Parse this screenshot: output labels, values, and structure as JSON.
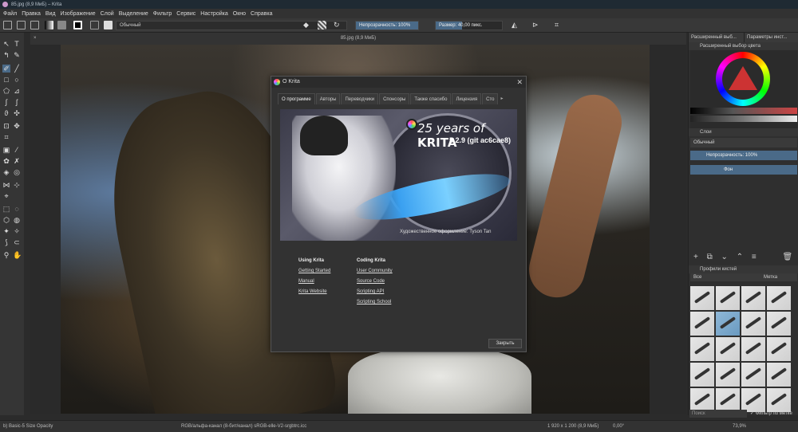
{
  "window": {
    "title": "85.jpg (8,9 МиБ) – Krita"
  },
  "menu": [
    "Файл",
    "Правка",
    "Вид",
    "Изображение",
    "Слой",
    "Выделение",
    "Фильтр",
    "Сервис",
    "Настройка",
    "Окно",
    "Справка"
  ],
  "toolbar": {
    "preset_name": "Обычный",
    "opacity_label": "Непрозрачность: 100%",
    "opacity_value": 100,
    "size_label": "Размер: 40,00 пикс.",
    "size_value": 40
  },
  "document": {
    "tab_title": "85.jpg (8,9 МиБ)",
    "close_glyph": "×"
  },
  "right_panel": {
    "tabs": [
      "Расширенный выб...",
      "Параметры инст..."
    ],
    "color_dock_title": "Расширенный выбор цвета",
    "layers_title": "Слои",
    "blend_mode": "Обычный",
    "opacity_label": "Непрозрачность: 100%",
    "layer_name": "Фон",
    "brush_presets_title": "Профили кистей",
    "brush_filter_value": "Все",
    "brush_tag_label": "Метка",
    "brush_search_placeholder": "Поиск",
    "brush_tag_filter_label": "Фильтр по метке",
    "brush_selected_index": 5
  },
  "dialog": {
    "title": "О Krita",
    "tabs": [
      "О программе",
      "Авторы",
      "Переводчики",
      "Спонсоры",
      "Также спасибо",
      "Лицензия",
      "Сто"
    ],
    "active_tab": "О программе",
    "splash_title_prefix": "25 years of ",
    "splash_title_brand": "KRITA",
    "version": "5.2.9 (git ac6cae8)",
    "artwork_credit": "Художественное оформление: Tyson Tan",
    "using_heading": "Using Krita",
    "using_links": [
      "Getting Started",
      "Manual",
      "Krita Website"
    ],
    "coding_heading": "Coding Krita",
    "coding_links": [
      "User Community",
      "Source Code",
      "Scripting API",
      "Scripting School"
    ],
    "close_button": "Закрыть"
  },
  "status": {
    "brush": "b) Basic-5 Size Opacity",
    "color_profile": "RGB/альфа-канал (8-бит/канал) sRGB-elle-V2-srgbtrc.icc",
    "dimensions": "1 920 x 1 200 (8,9 МиБ)",
    "rotation": "0,00°",
    "zoom": "73,9%"
  }
}
